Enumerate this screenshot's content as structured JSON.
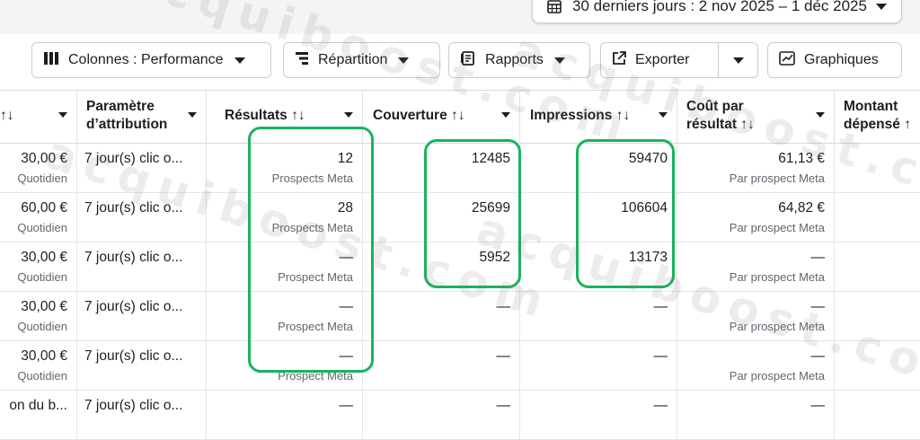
{
  "date_range": {
    "label": "30 derniers jours : 2 nov 2025 – 1 déc 2025"
  },
  "toolbar": {
    "columns_label": "Colonnes : Performance",
    "breakdown_label": "Répartition",
    "reports_label": "Rapports",
    "export_label": "Exporter",
    "charts_label": "Graphiques"
  },
  "columns": {
    "budget_suffix": "↑↓",
    "attribution": [
      "Paramètre",
      "d’attribution"
    ],
    "results": "Résultats ↑↓",
    "reach": "Couverture ↑↓",
    "impressions": "Impressions ↑↓",
    "cost_per_result": [
      "Coût par",
      "résultat ↑↓"
    ],
    "amount_spent": [
      "Montant",
      "dépensé ↑"
    ]
  },
  "rows": [
    {
      "budget": "30,00 €",
      "budget_type": "Quotidien",
      "attribution": "7 jour(s) clic o...",
      "results": "12",
      "results_sub": "Prospects Meta",
      "reach": "12485",
      "impressions": "59470",
      "cost": "61,13 €",
      "cost_sub": "Par prospect Meta"
    },
    {
      "budget": "60,00 €",
      "budget_type": "Quotidien",
      "attribution": "7 jour(s) clic o...",
      "results": "28",
      "results_sub": "Prospects Meta",
      "reach": "25699",
      "impressions": "106604",
      "cost": "64,82 €",
      "cost_sub": "Par prospect Meta"
    },
    {
      "budget": "30,00 €",
      "budget_type": "Quotidien",
      "attribution": "7 jour(s) clic o...",
      "results": "—",
      "results_sub": "Prospect Meta",
      "reach": "5952",
      "impressions": "13173",
      "cost": "—",
      "cost_sub": "Par prospect Meta"
    },
    {
      "budget": "30,00 €",
      "budget_type": "Quotidien",
      "attribution": "7 jour(s) clic o...",
      "results": "—",
      "results_sub": "Prospect Meta",
      "reach": "—",
      "impressions": "—",
      "cost": "—",
      "cost_sub": "Par prospect Meta"
    },
    {
      "budget": "30,00 €",
      "budget_type": "Quotidien",
      "attribution": "7 jour(s) clic o...",
      "results": "—",
      "results_sub": "Prospect Meta",
      "reach": "—",
      "impressions": "—",
      "cost": "—",
      "cost_sub": "Par prospect Meta"
    },
    {
      "budget": "on du b...",
      "budget_type": "",
      "attribution": "7 jour(s) clic o...",
      "results": "—",
      "results_sub": "",
      "reach": "—",
      "impressions": "—",
      "cost": "—",
      "cost_sub": ""
    }
  ],
  "watermark": {
    "text": "acquiboost.com"
  },
  "colors": {
    "highlight": "#19b35c",
    "border": "#c9ccd1"
  }
}
